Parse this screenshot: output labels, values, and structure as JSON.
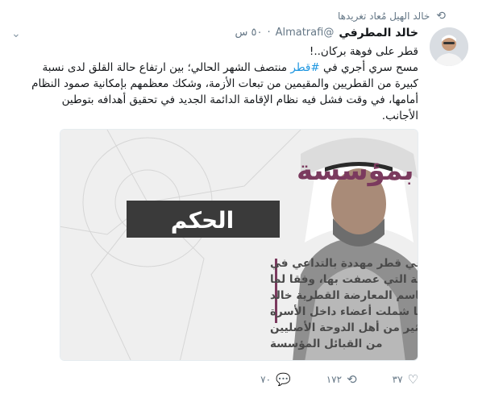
{
  "retweet": {
    "text": "خالد الهيل مُعاد تغريدها",
    "icon": "retweet-icon"
  },
  "author": {
    "display_name": "خالد المطرفي",
    "handle": "@Almatrafi",
    "separator": "·",
    "time": "٥٠ س"
  },
  "tweet": {
    "line1": "قطر على فوهة بركان..!",
    "line2_before": "مسح سري أجري في ",
    "hashtag": "#قطر",
    "line2_after": " منتصف الشهر الحالي؛ بين ارتفاع حالة القلق لدى نسبة",
    "line3": "كبيرة من القطريين والمقيمين من تبعات الأزمة، وشكك معظمهم بإمكانية صمود النظام",
    "line4": "أمامها، في وقت فشل فيه نظام الإقامة الدائمة الجديد في تحقيق أهدافه بتوطين",
    "line5": "الأجانب."
  },
  "image": {
    "headline": "انشقاق بمؤسسة",
    "subheadline": "الحكم",
    "body_lines": [
      "باتت مؤسسة الحكم في قطر مهددة بالتداعي في",
      "ظل الانشقاقات الواسعة التي عصفت بها، وفقا لما",
      "كشف عنه المتحدث باسم المعارضة القطرية خالد",
      "الهيل، موضحا أنها شملت أعضاء داخل الأسرة",
      "الحاكمة القطرية والكثير من أهل الدوحة الأصليين",
      "من القبائل المؤسسة"
    ],
    "colors": {
      "headline": "#7b3a5e",
      "band": "#3a3a3a",
      "text": "#4a4a4a",
      "bg": "#efefef"
    }
  },
  "actions": {
    "reply": "٧٠",
    "retweet": "١٧٢",
    "like": "٣٧"
  }
}
